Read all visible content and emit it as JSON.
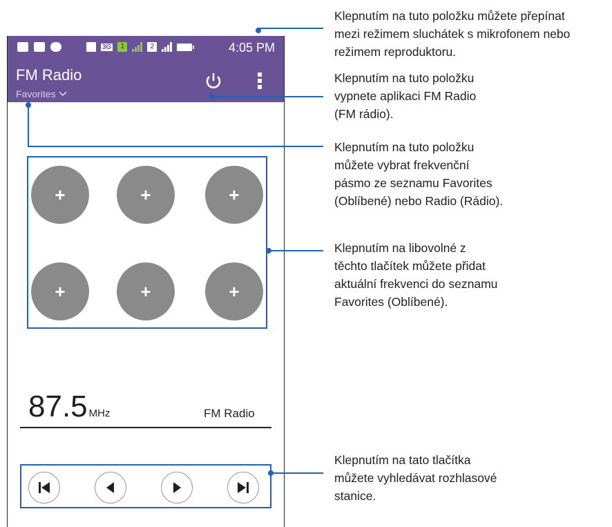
{
  "statusbar": {
    "time": "4:05 PM",
    "network": "3G",
    "sim1": "1",
    "sim2": "2"
  },
  "app": {
    "title": "FM Radio",
    "subtitle": "Favorites",
    "favorite_button_label": "+",
    "frequency_value": "87.5",
    "frequency_unit": "MHz",
    "station_label": "FM Radio"
  },
  "callouts": [
    {
      "lines": [
        "Klepnutím na tuto položku můžete přepínat",
        "mezi režimem sluchátek s mikrofonem nebo",
        "režimem reproduktoru."
      ]
    },
    {
      "lines": [
        "Klepnutím na tuto položku",
        "vypnete aplikaci FM Radio",
        "(FM rádio)."
      ]
    },
    {
      "lines": [
        "Klepnutím na tuto položku",
        "můžete vybrat frekvenční",
        "pásmo ze seznamu Favorites",
        "(Oblíbené) nebo Radio (Rádio)."
      ]
    },
    {
      "lines": [
        "Klepnutím na libovolné z",
        "těchto tlačítek můžete přidat",
        "aktuální frekvenci do seznamu",
        "Favorites (Oblíbené)."
      ]
    },
    {
      "lines": [
        "Klepnutím na tato tlačítka",
        "můžete vyhledávat rozhlasové",
        "stanice."
      ]
    }
  ],
  "icons": {
    "power": "power-icon",
    "menu": "overflow-menu-icon",
    "dropdown": "chevron-down-icon",
    "prev_station": "skip-previous-icon",
    "seek_back": "seek-back-icon",
    "seek_forward": "seek-forward-icon",
    "next_station": "skip-next-icon"
  },
  "colors": {
    "toolbar": "#6a5296",
    "callout": "#1f62b6",
    "fav_button": "#8a8a8a"
  }
}
